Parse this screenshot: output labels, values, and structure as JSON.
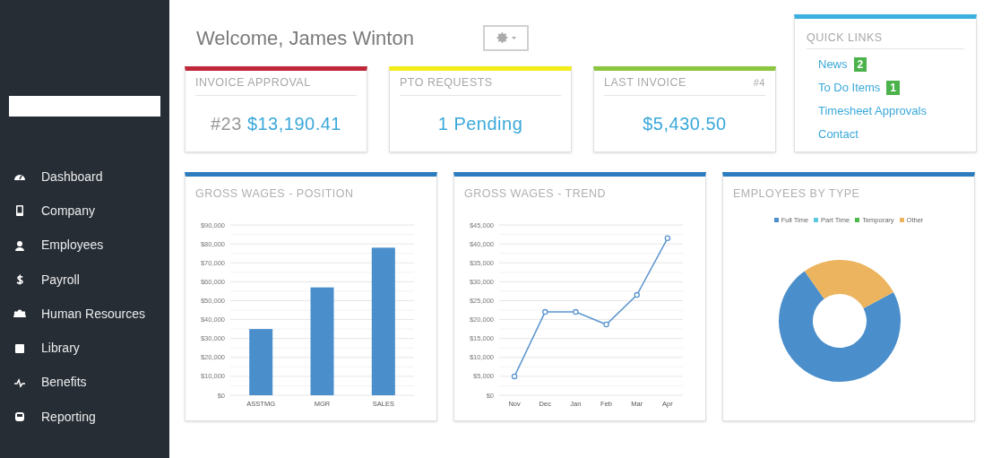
{
  "sidebar": {
    "items": [
      {
        "label": "Dashboard"
      },
      {
        "label": "Company"
      },
      {
        "label": "Employees"
      },
      {
        "label": "Payroll"
      },
      {
        "label": "Human Resources"
      },
      {
        "label": "Library"
      },
      {
        "label": "Benefits"
      },
      {
        "label": "Reporting"
      }
    ]
  },
  "header": {
    "welcome": "Welcome, James Winton"
  },
  "stat_cards": [
    {
      "title": "INVOICE APPROVAL",
      "color": "#c0283a",
      "prefix": "#23",
      "value": "$13,190.41"
    },
    {
      "title": "PTO REQUESTS",
      "color": "#f3ee1a",
      "value": "1 Pending"
    },
    {
      "title": "LAST INVOICE",
      "color": "#8cc63f",
      "tag": "#4",
      "value": "$5,430.50"
    }
  ],
  "quick_links": {
    "title": "QUICK LINKS",
    "links": [
      {
        "label": "News",
        "badge": "2"
      },
      {
        "label": "To Do Items",
        "badge": "1"
      },
      {
        "label": "Timesheet Approvals"
      },
      {
        "label": "Contact"
      }
    ]
  },
  "charts": [
    {
      "title": "GROSS WAGES - POSITION",
      "chart_data": {
        "type": "bar",
        "categories": [
          "ASSTMG",
          "MGR",
          "SALES"
        ],
        "series": [
          {
            "color": "#4a8ecb",
            "values": [
              35000,
              57000,
              78000
            ]
          }
        ],
        "grid": true,
        "ylim": [
          0,
          90000
        ],
        "yticks": [
          {
            "value": 0,
            "label": "$0"
          },
          {
            "value": 10000,
            "label": "$10,000"
          },
          {
            "value": 20000,
            "label": "$20,000"
          },
          {
            "value": 30000,
            "label": "$30,000"
          },
          {
            "value": 40000,
            "label": "$40,000"
          },
          {
            "value": 50000,
            "label": "$50,000"
          },
          {
            "value": 60000,
            "label": "$60,000"
          },
          {
            "value": 70000,
            "label": "$70,000"
          },
          {
            "value": 80000,
            "label": "$80,000"
          },
          {
            "value": 90000,
            "label": "$90,000"
          }
        ]
      }
    },
    {
      "title": "GROSS WAGES - TREND",
      "chart_data": {
        "type": "line",
        "categories": [
          "Nov",
          "Dec",
          "Jan",
          "Feb",
          "Mar",
          "Apr"
        ],
        "series": [
          {
            "color": "#5b95cf",
            "marker": "circle",
            "values": [
              5000,
              22000,
              22000,
              18700,
              26500,
              41500
            ]
          }
        ],
        "grid": true,
        "ylim": [
          0,
          45000
        ],
        "yticks": [
          {
            "value": 0,
            "label": "$0"
          },
          {
            "value": 5000,
            "label": "$5,000"
          },
          {
            "value": 10000,
            "label": "$10,000"
          },
          {
            "value": 15000,
            "label": "$15,000"
          },
          {
            "value": 20000,
            "label": "$20,000"
          },
          {
            "value": 25000,
            "label": "$25,000"
          },
          {
            "value": 30000,
            "label": "$30,000"
          },
          {
            "value": 35000,
            "label": "$35,000"
          },
          {
            "value": 40000,
            "label": "$40,000"
          },
          {
            "value": 45000,
            "label": "$45,000"
          }
        ]
      }
    },
    {
      "title": "EMPLOYEES BY TYPE",
      "chart_data": {
        "type": "donut",
        "categories": [
          "Full Time",
          "Part Time",
          "Temporary",
          "Other"
        ],
        "series": [
          {
            "values": [
              73,
              0,
              0,
              27
            ]
          }
        ],
        "legend": true,
        "colors": [
          "#4a8ecb",
          "#5bc8e0",
          "#4cbb4c",
          "#ecb45e"
        ]
      }
    }
  ]
}
